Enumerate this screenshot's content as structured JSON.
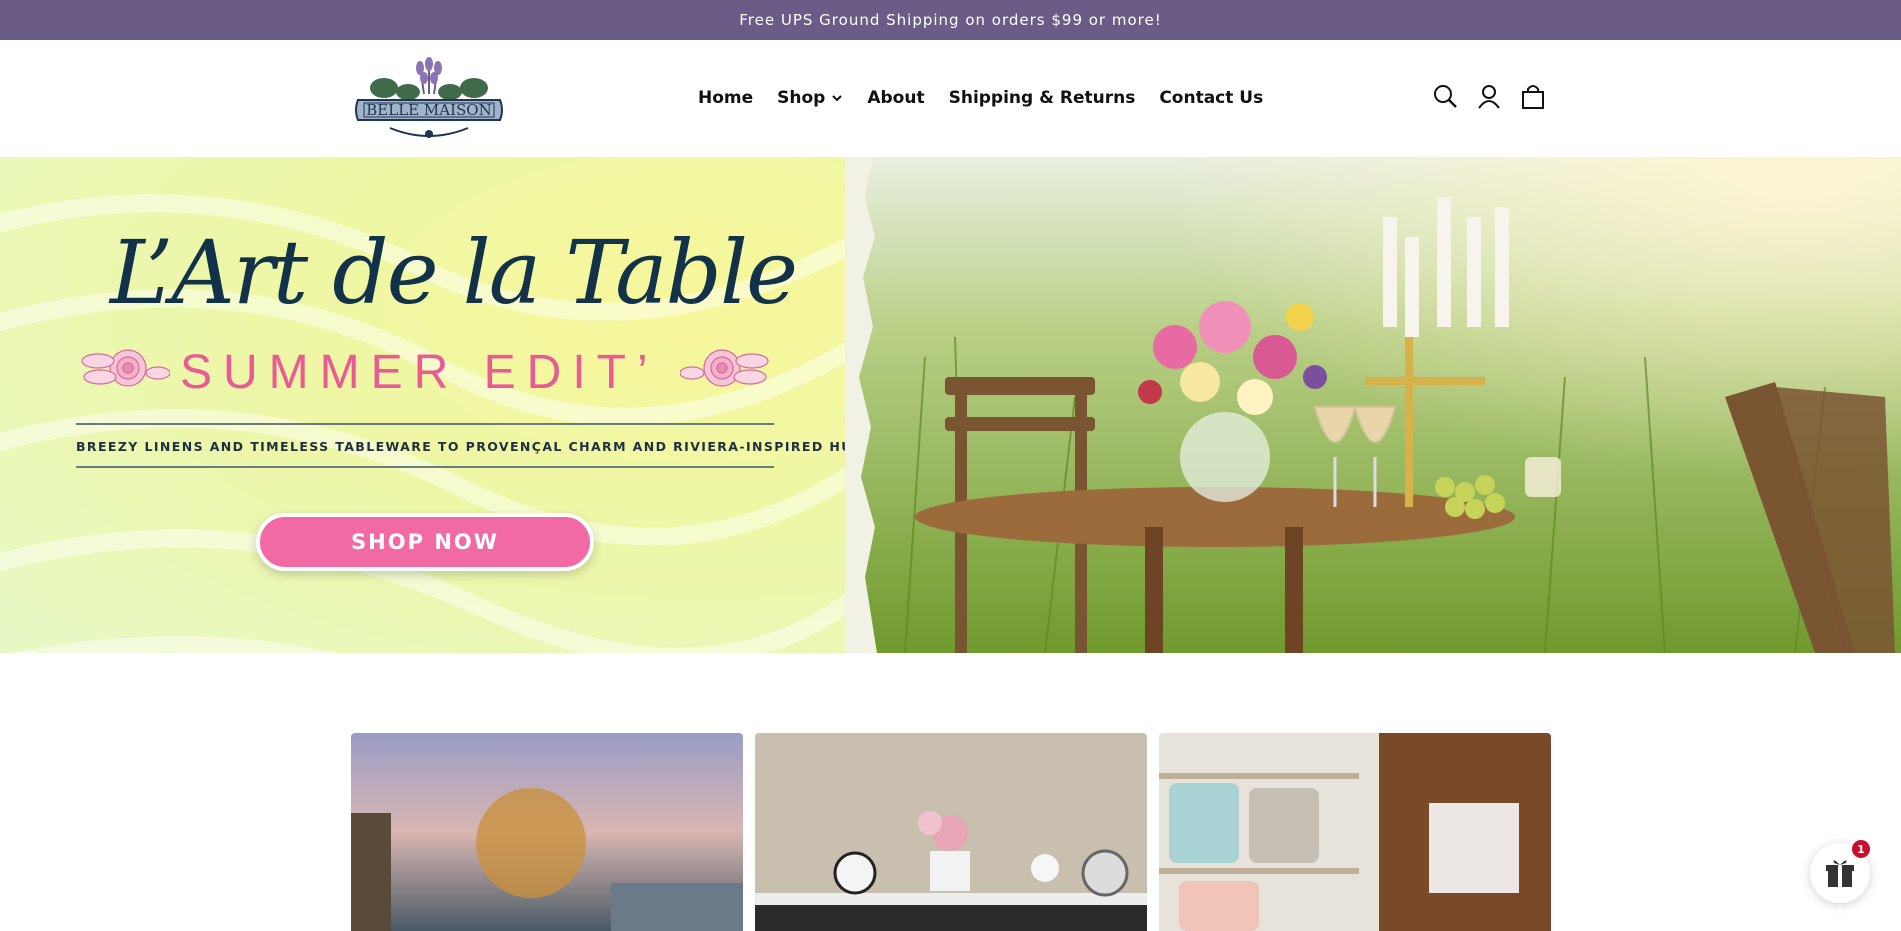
{
  "announcement": {
    "text": "Free UPS Ground Shipping on orders $99 or more!"
  },
  "brand": {
    "name": "BELLE MAISON"
  },
  "nav": {
    "items": [
      {
        "label": "Home"
      },
      {
        "label": "Shop",
        "has_dropdown": true
      },
      {
        "label": "About"
      },
      {
        "label": "Shipping & Returns"
      },
      {
        "label": "Contact Us"
      }
    ]
  },
  "header_icons": [
    "search-icon",
    "account-icon",
    "cart-icon"
  ],
  "hero": {
    "title": "L’Art de la Table",
    "subtitle": "SUMMER EDIT’",
    "tagline": "BREEZY LINENS AND TIMELESS TABLEWARE TO PROVENÇAL CHARM AND RIVIERA-INSPIRED HUES",
    "cta_label": "SHOP NOW"
  },
  "colors": {
    "announcement_bg": "#6b5b87",
    "cta_bg": "#f26aa4",
    "title_color": "#12324a",
    "subtitle_color": "#ea5a93",
    "badge_bg": "#c8102e"
  },
  "gift_widget": {
    "icon": "gift-icon",
    "badge_count": "1"
  }
}
